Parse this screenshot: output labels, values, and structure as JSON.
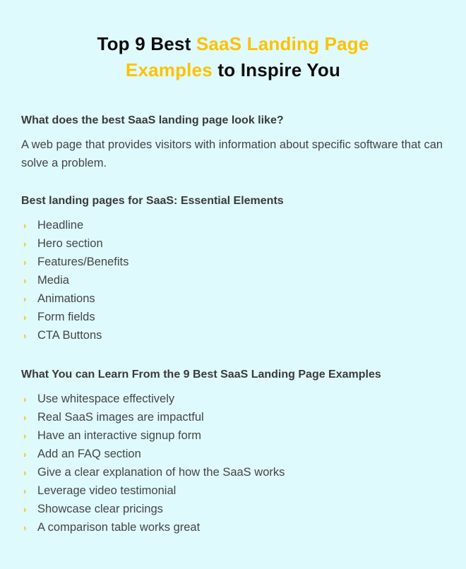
{
  "title": {
    "part1": "Top 9 Best ",
    "accent1": "SaaS Landing Page",
    "accent2": "Examples",
    "part2": " to Inspire You"
  },
  "colors": {
    "background": "#dffafc",
    "accent": "#fcc200",
    "title_text": "#0c0c0c",
    "body_text": "#444444",
    "bullet": "#fcb900"
  },
  "sections": [
    {
      "heading": "What does the best SaaS landing page look like?",
      "paragraph": "A web page that provides visitors with information about specific software that can solve a problem."
    },
    {
      "heading": "Best landing pages for SaaS: Essential Elements",
      "bullet_icon": "chevron-right-icon",
      "items": [
        "Headline",
        "Hero section",
        "Features/Benefits",
        "Media",
        "Animations",
        "Form fields",
        "CTA Buttons"
      ]
    },
    {
      "heading": "What You can Learn From the 9 Best SaaS Landing Page Examples",
      "bullet_icon": "chevron-right-icon",
      "items": [
        "Use whitespace effectively",
        "Real SaaS images are impactful",
        "Have an interactive signup form",
        "Add an FAQ section",
        "Give a clear explanation of how the SaaS works",
        "Leverage video testimonial",
        "Showcase clear pricings",
        "A comparison table works great"
      ]
    }
  ]
}
